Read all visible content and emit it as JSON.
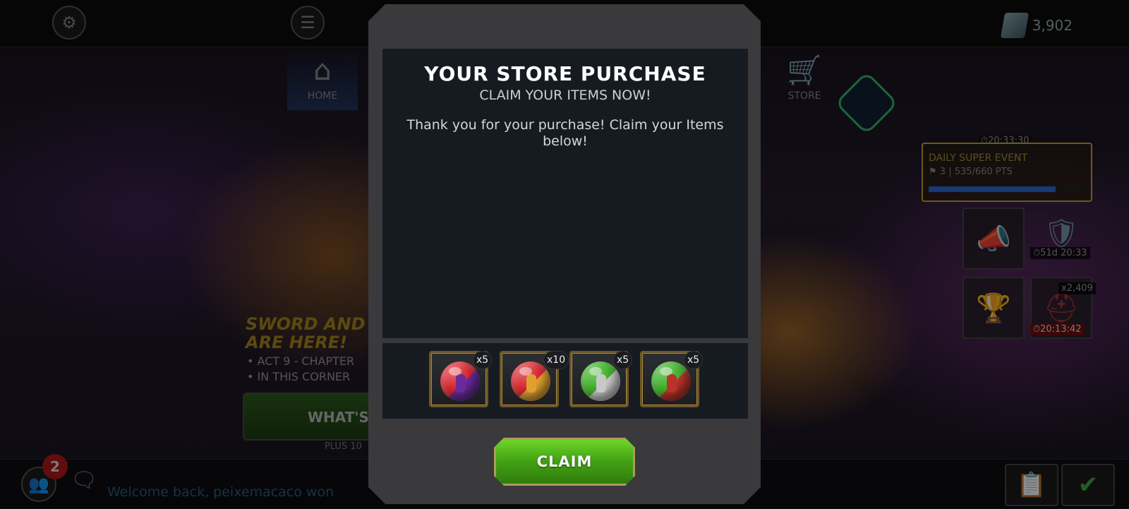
{
  "top_bar": {
    "currency_value": "3,902",
    "tabs": [
      {
        "label": "HOME",
        "icon": "house-icon"
      },
      {
        "label": "STORE",
        "icon": "cart-icon"
      }
    ]
  },
  "event": {
    "timer": "⏱20:33:30",
    "title": "DAILY SUPER EVENT",
    "points": "⚑ 3 | 535/660 PTS",
    "progress": 0.81
  },
  "side_tiles": {
    "tile_a_timer": "⏱51d 20:33",
    "tile_b_count": "x2,409",
    "tile_b_timer": "⏱20:13:42"
  },
  "promo": {
    "title_line1": "SWORD AND S",
    "title_line2": "ARE HERE!",
    "bullet1": "• ACT 9 - CHAPTER",
    "bullet2": "• IN THIS CORNER",
    "button_label": "WHAT'S",
    "plus_text": "PLUS 10"
  },
  "chat": {
    "badge_count": "2",
    "message": "Welcome back, peixemacaco won"
  },
  "modal": {
    "title": "YOUR STORE PURCHASE",
    "subtitle": "CLAIM YOUR ITEMS NOW!",
    "body": "Thank you for your purchase! Claim your Items below!",
    "items": [
      {
        "quantity": "x5",
        "icon": "red-purple-potion-orb-icon",
        "color_a": "#d8262e",
        "color_b": "#6a2a9a"
      },
      {
        "quantity": "x10",
        "icon": "red-gold-potion-orb-icon",
        "color_a": "#d8262e",
        "color_b": "#e0a030"
      },
      {
        "quantity": "x5",
        "icon": "green-silver-potion-orb-icon",
        "color_a": "#3fb12a",
        "color_b": "#c8c8c8"
      },
      {
        "quantity": "x5",
        "icon": "green-red-potion-orb-icon",
        "color_a": "#3fb12a",
        "color_b": "#b8332a"
      }
    ],
    "claim_label": "CLAIM"
  },
  "colors": {
    "modal_frame": "#3a3a3c",
    "panel": "#161b22",
    "claim_green": "#45a515",
    "gold_border": "#a98a3a"
  }
}
